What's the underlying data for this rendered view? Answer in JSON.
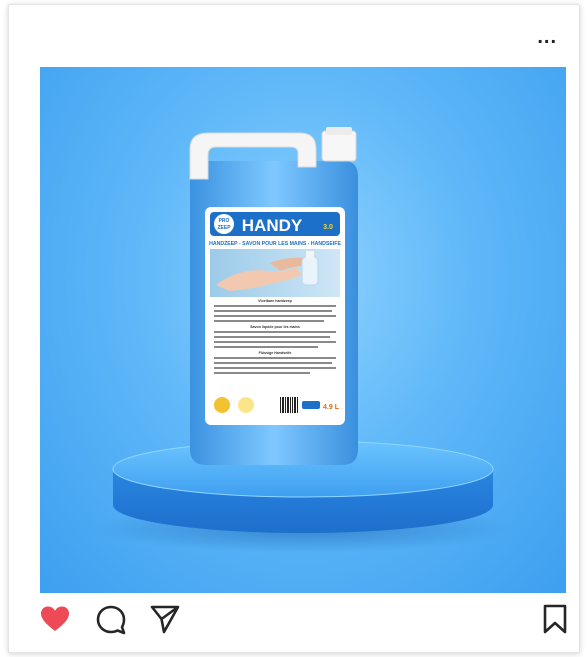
{
  "post": {
    "more_label": "...",
    "liked": true
  },
  "product": {
    "brand_small": "PRO",
    "brand_badge": "ZEEP",
    "brand_name": "HANDY",
    "brand_suffix": "3.0",
    "subtitle": "HANDZEEP - SAVON POUR LES MAINS - HANDSEIFE",
    "section_nl": "Vloeibare handzeep",
    "section_fr": "Savon liquide pour les mains",
    "section_de": "Flüssige Handseife",
    "volume": "4.9 L"
  },
  "colors": {
    "heart": "#ed4956",
    "icon": "#262626",
    "bg_light": "#8fd2ff",
    "bg_dark": "#3d9ff0"
  },
  "icons": {
    "like": "heart-icon",
    "comment": "comment-icon",
    "share": "paper-plane-icon",
    "save": "bookmark-icon",
    "more": "more-horizontal-icon"
  }
}
